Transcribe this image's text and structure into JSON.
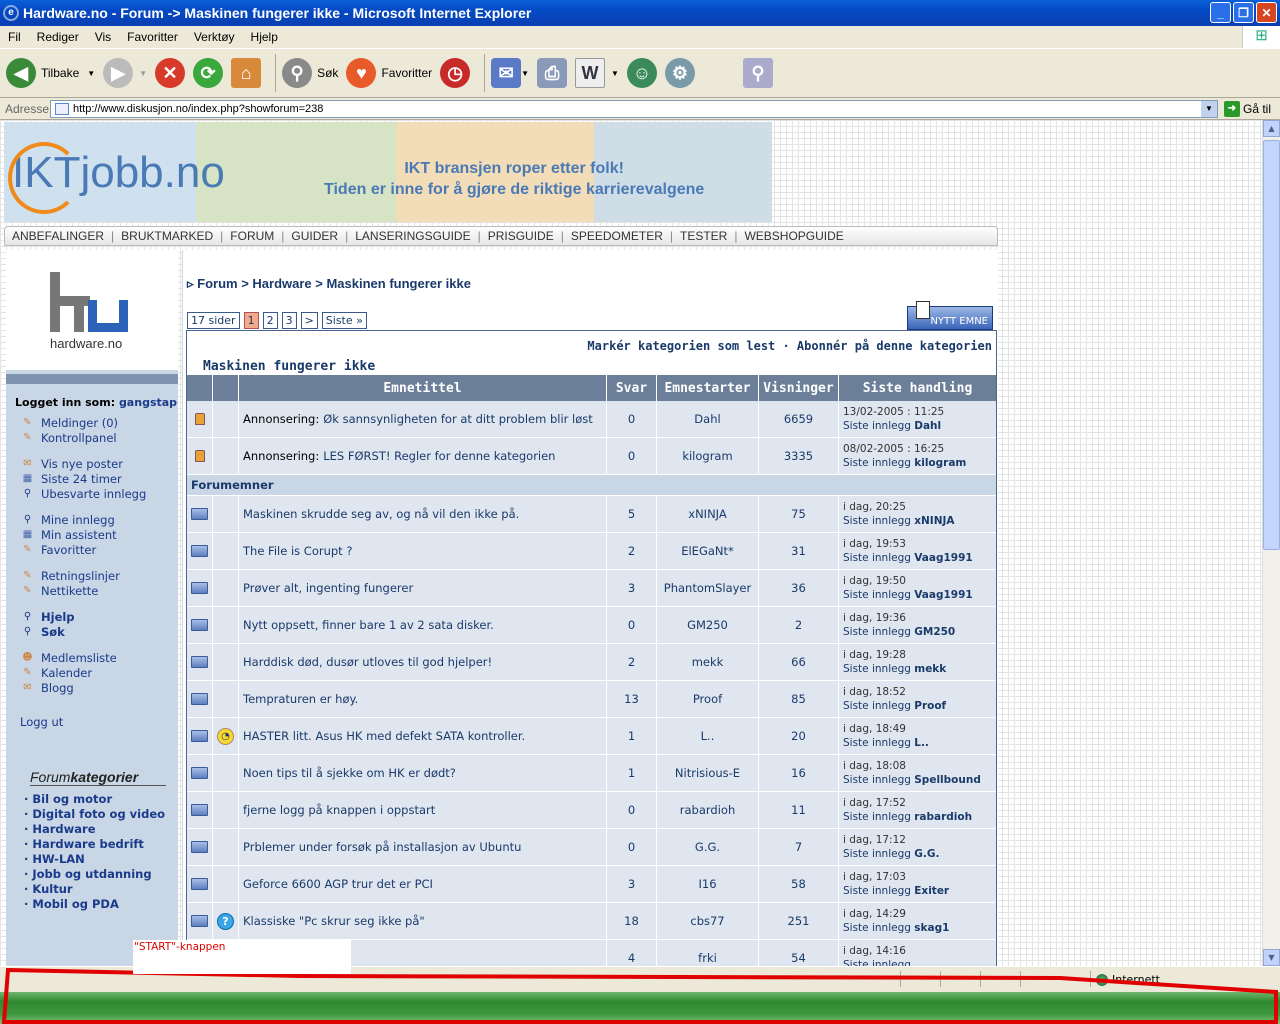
{
  "window": {
    "title": "Hardware.no - Forum -> Maskinen fungerer ikke - Microsoft Internet Explorer"
  },
  "menubar": {
    "items": [
      "Fil",
      "Rediger",
      "Vis",
      "Favoritter",
      "Verktøy",
      "Hjelp"
    ]
  },
  "toolbar": {
    "back_label": "Tilbake",
    "search_label": "Søk",
    "favorites_label": "Favoritter"
  },
  "addressbar": {
    "label": "Adresse",
    "url": "http://www.diskusjon.no/index.php?showforum=238",
    "go_label": "Gå til"
  },
  "banner": {
    "logo": "IKTjobb.no",
    "tagline1": "IKT bransjen roper etter folk!",
    "tagline2": "Tiden er inne for å gjøre de riktige karrierevalgene"
  },
  "nav": {
    "items": [
      "ANBEFALINGER",
      "BRUKTMARKED",
      "FORUM",
      "GUIDER",
      "LANSERINGSGUIDE",
      "PRISGUIDE",
      "SPEEDOMETER",
      "TESTER",
      "WEBSHOPGUIDE"
    ]
  },
  "sidebar": {
    "logo_text": "hardware.no",
    "logged_in_label": "Logget inn som:",
    "username": "gangstap",
    "links1": [
      "Meldinger (0)",
      "Kontrollpanel"
    ],
    "links2": [
      "Vis nye poster",
      "Siste 24 timer",
      "Ubesvarte innlegg"
    ],
    "links3": [
      "Mine innlegg",
      "Min assistent",
      "Favoritter"
    ],
    "links4": [
      "Retningslinjer",
      "Nettikette"
    ],
    "links5": [
      "Hjelp",
      "Søk"
    ],
    "links6": [
      "Medlemsliste",
      "Kalender",
      "Blogg"
    ],
    "logout": "Logg ut",
    "cat_title_a": "Forum",
    "cat_title_b": "kategorier",
    "categories": [
      "· Bil og motor",
      "· Digital foto og video",
      "· Hardware",
      "· Hardware bedrift",
      "· HW-LAN",
      "· Jobb og utdanning",
      "· Kultur",
      "· Mobil og PDA"
    ]
  },
  "breadcrumb": {
    "text": "▹ Forum > Hardware > Maskinen fungerer ikke"
  },
  "pager": {
    "pages_label": "17 sider",
    "current": "1",
    "p2": "2",
    "p3": "3",
    "next": ">",
    "last": "Siste »"
  },
  "new_topic_label": "NYTT EMNE",
  "forum": {
    "name": "Maskinen fungerer ikke",
    "actions": "Markér kategorien som lest · Abonnér på denne kategorien",
    "section_label": "Forumemner",
    "headers": {
      "title": "Emnetittel",
      "replies": "Svar",
      "starter": "Emnestarter",
      "views": "Visninger",
      "last": "Siste handling"
    },
    "last_prefix": "Siste innlegg",
    "pinned": [
      {
        "prefix": "Annonsering:",
        "title": "Øk sannsynligheten for at ditt problem blir løst",
        "replies": "0",
        "starter": "Dahl",
        "views": "6659",
        "when": "13/02-2005 : 11:25",
        "last_by": "Dahl"
      },
      {
        "prefix": "Annonsering:",
        "title": "LES FØRST! Regler for denne kategorien",
        "replies": "0",
        "starter": "kilogram",
        "views": "3335",
        "when": "08/02-2005 : 16:25",
        "last_by": "kilogram"
      }
    ],
    "topics": [
      {
        "title": "Maskinen skrudde seg av, og nå vil den ikke på.",
        "replies": "5",
        "starter": "xNINJA",
        "views": "75",
        "when": "i dag, 20:25",
        "last_by": "xNINJA",
        "icon": ""
      },
      {
        "title": "The File is Corupt ?",
        "replies": "2",
        "starter": "ElEGaNt*",
        "views": "31",
        "when": "i dag, 19:53",
        "last_by": "Vaag1991",
        "icon": ""
      },
      {
        "title": "Prøver alt, ingenting fungerer",
        "replies": "3",
        "starter": "PhantomSlayer",
        "views": "36",
        "when": "i dag, 19:50",
        "last_by": "Vaag1991",
        "icon": ""
      },
      {
        "title": "Nytt oppsett, finner bare 1 av 2 sata disker.",
        "replies": "0",
        "starter": "GM250",
        "views": "2",
        "when": "i dag, 19:36",
        "last_by": "GM250",
        "icon": ""
      },
      {
        "title": "Harddisk død, dusør utloves til god hjelper!",
        "replies": "2",
        "starter": "mekk",
        "views": "66",
        "when": "i dag, 19:28",
        "last_by": "mekk",
        "icon": ""
      },
      {
        "title": "Tempraturen er høy.",
        "replies": "13",
        "starter": "Proof",
        "views": "85",
        "when": "i dag, 18:52",
        "last_by": "Proof",
        "icon": ""
      },
      {
        "title": "HASTER litt. Asus HK med defekt SATA kontroller.",
        "replies": "1",
        "starter": "L..",
        "views": "20",
        "when": "i dag, 18:49",
        "last_by": "L..",
        "icon": "smile"
      },
      {
        "title": "Noen tips til å sjekke om HK er dødt?",
        "replies": "1",
        "starter": "Nitrisious-E",
        "views": "16",
        "when": "i dag, 18:08",
        "last_by": "Spellbound",
        "icon": ""
      },
      {
        "title": "fjerne logg på knappen i oppstart",
        "replies": "0",
        "starter": "rabardioh",
        "views": "11",
        "when": "i dag, 17:52",
        "last_by": "rabardioh",
        "icon": ""
      },
      {
        "title": "Prblemer under forsøk på installasjon av Ubuntu",
        "replies": "0",
        "starter": "G.G.",
        "views": "7",
        "when": "i dag, 17:12",
        "last_by": "G.G.",
        "icon": ""
      },
      {
        "title": "Geforce 6600 AGP trur det er PCI",
        "replies": "3",
        "starter": "I16",
        "views": "58",
        "when": "i dag, 17:03",
        "last_by": "Exiter",
        "icon": ""
      },
      {
        "title": "Klassiske \"Pc skrur seg ikke på\"",
        "replies": "18",
        "starter": "cbs77",
        "views": "251",
        "when": "i dag, 14:29",
        "last_by": "skag1",
        "icon": "question"
      },
      {
        "title": "",
        "replies": "4",
        "starter": "frki",
        "views": "54",
        "when": "i dag, 14:16",
        "last_by": "",
        "icon": ""
      }
    ]
  },
  "status": {
    "zone": "Internett"
  },
  "tooltip": {
    "text": "\"START\"-knappen"
  }
}
